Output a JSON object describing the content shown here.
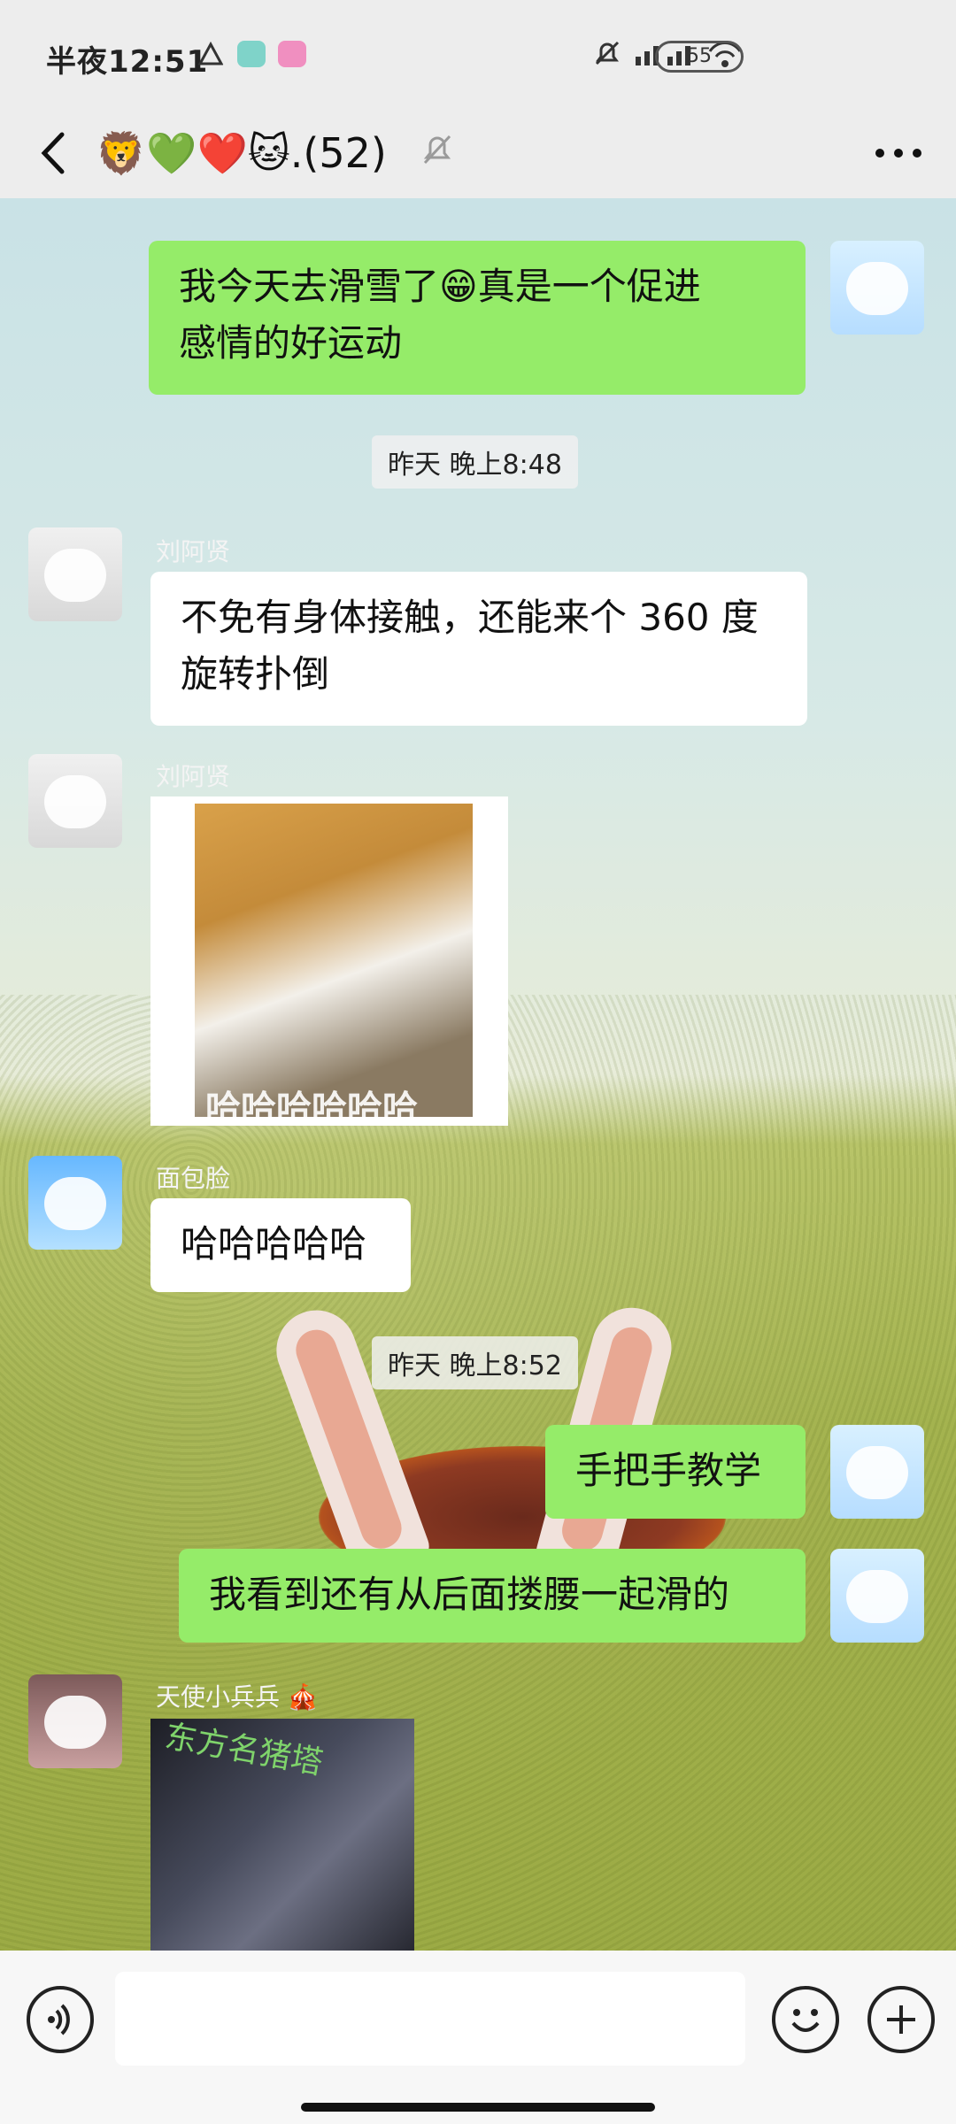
{
  "status": {
    "time": "半夜12:51",
    "battery": "55"
  },
  "header": {
    "title": "🦁💚❤️🐱.(52)"
  },
  "messages": [
    {
      "type": "text",
      "side": "right",
      "text_lines": [
        "我今天去滑雪了😁真是一个促进",
        "感情的好运动"
      ]
    },
    {
      "type": "time",
      "text": "昨天 晚上8:48"
    },
    {
      "type": "text",
      "side": "left",
      "sender": "刘阿贤",
      "text_lines": [
        "不免有身体接触，还能来个 360 度",
        "旋转扑倒"
      ]
    },
    {
      "type": "image",
      "side": "left",
      "sender": "刘阿贤",
      "caption": "哈哈哈哈哈哈"
    },
    {
      "type": "text",
      "side": "left",
      "sender": "面包脸",
      "text": "哈哈哈哈哈"
    },
    {
      "type": "time",
      "text": "昨天 晚上8:52"
    },
    {
      "type": "text",
      "side": "right",
      "text": "手把手教学"
    },
    {
      "type": "text",
      "side": "right",
      "text": "我看到还有从后面搂腰一起滑的"
    },
    {
      "type": "image",
      "side": "left",
      "sender": "天使小兵兵 🎪",
      "caption": "东方名猪塔"
    }
  ]
}
